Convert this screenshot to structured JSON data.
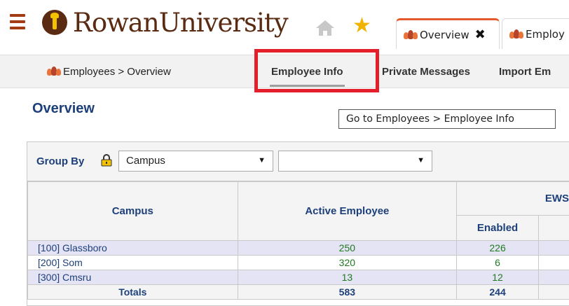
{
  "brand": {
    "name": "RowanUniversity"
  },
  "tabs": [
    {
      "label": "Overview",
      "active": true
    },
    {
      "label": "Employ",
      "active": false
    }
  ],
  "breadcrumb": "Employees > Overview",
  "menu": {
    "employee_info": "Employee Info",
    "private_messages": "Private Messages",
    "import": "Import Em"
  },
  "tooltip": "Go to Employees > Employee Info",
  "page_title": "Overview",
  "group_by": {
    "label": "Group By",
    "primary_value": "Campus",
    "secondary_value": ""
  },
  "table": {
    "headers": {
      "campus": "Campus",
      "active_employee": "Active Employee",
      "ews_group": "EWS",
      "enabled": "Enabled"
    },
    "rows": [
      {
        "campus": "[100] Glassboro",
        "active": "250",
        "enabled": "226"
      },
      {
        "campus": "[200] Som",
        "active": "320",
        "enabled": "6"
      },
      {
        "campus": "[300] Cmsru",
        "active": "13",
        "enabled": "12"
      }
    ],
    "totals": {
      "label": "Totals",
      "active": "583",
      "enabled": "244"
    }
  },
  "colors": {
    "accent": "#e55a2b",
    "brand_brown": "#5a2a12",
    "header_blue": "#1d3f7a",
    "value_green": "#1f7a1f",
    "highlight_red": "#e41e2a"
  }
}
